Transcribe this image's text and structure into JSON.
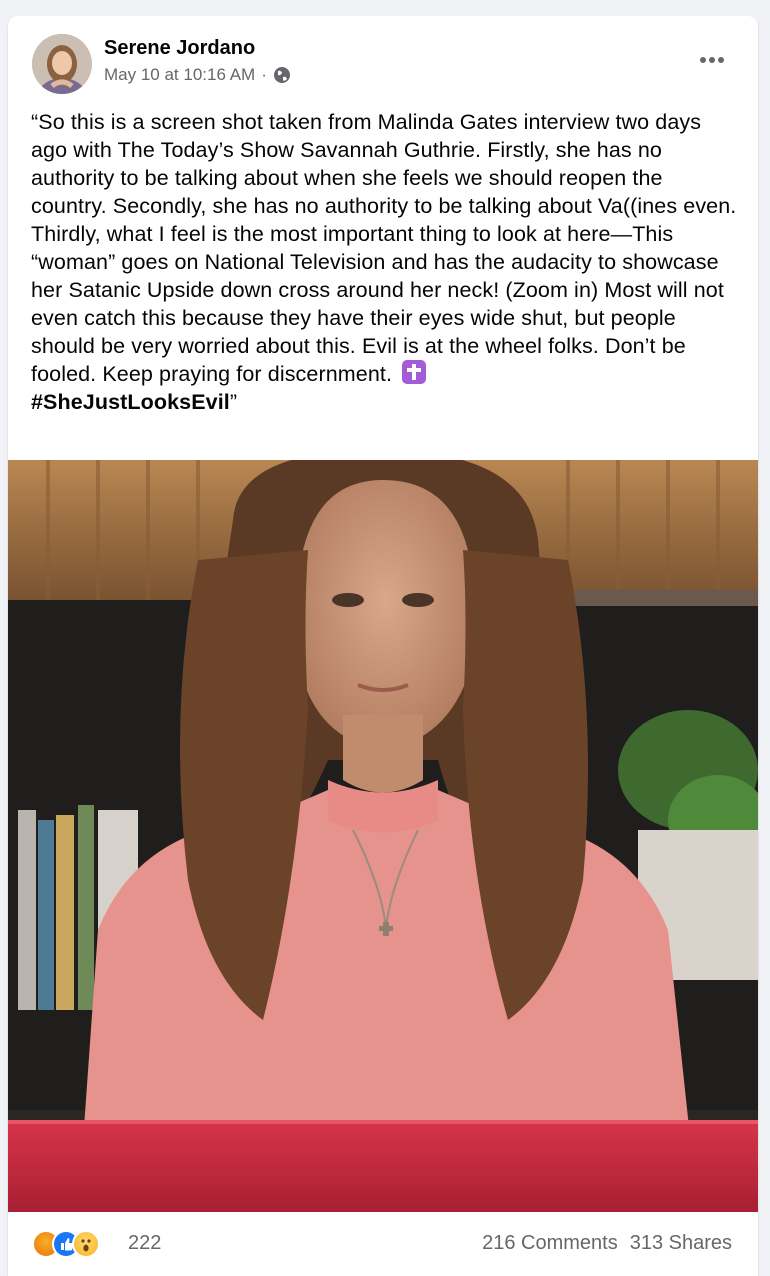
{
  "post": {
    "author": "Serene Jordano",
    "timestamp": "May 10 at 10:16 AM",
    "separator": "·",
    "privacy_icon": "globe-icon",
    "more_icon": "more-options-icon",
    "text": "“So this is a screen shot taken from Malinda Gates interview two days ago with The Today’s Show Savannah Guthrie. Firstly, she has no authority to be talking about when she feels we should reopen the country. Secondly, she has no authority to be talking about Va((ines even. Thirdly, what I feel is the most important thing to look at here—This “woman” goes on National Television and has the audacity to showcase her Satanic Upside down cross around her neck! (Zoom in) Most will not even catch this because they have their eyes wide shut, but people should be very worried about this. Evil is at the wheel folks. Don’t be fooled. Keep praying for discernment.",
    "emoji": "latin-cross-emoji",
    "hashtag": "#SheJustLooksEvil",
    "closing_quote": "”"
  },
  "engagement": {
    "reaction_icons": [
      "angry-reaction-icon",
      "like-reaction-icon",
      "wow-reaction-icon"
    ],
    "reaction_count": "222",
    "comments": "216 Comments",
    "shares": "313 Shares"
  },
  "colors": {
    "background": "#f0f2f5",
    "card": "#ffffff",
    "secondary_text": "#65676b",
    "like_blue": "#1877f2"
  }
}
